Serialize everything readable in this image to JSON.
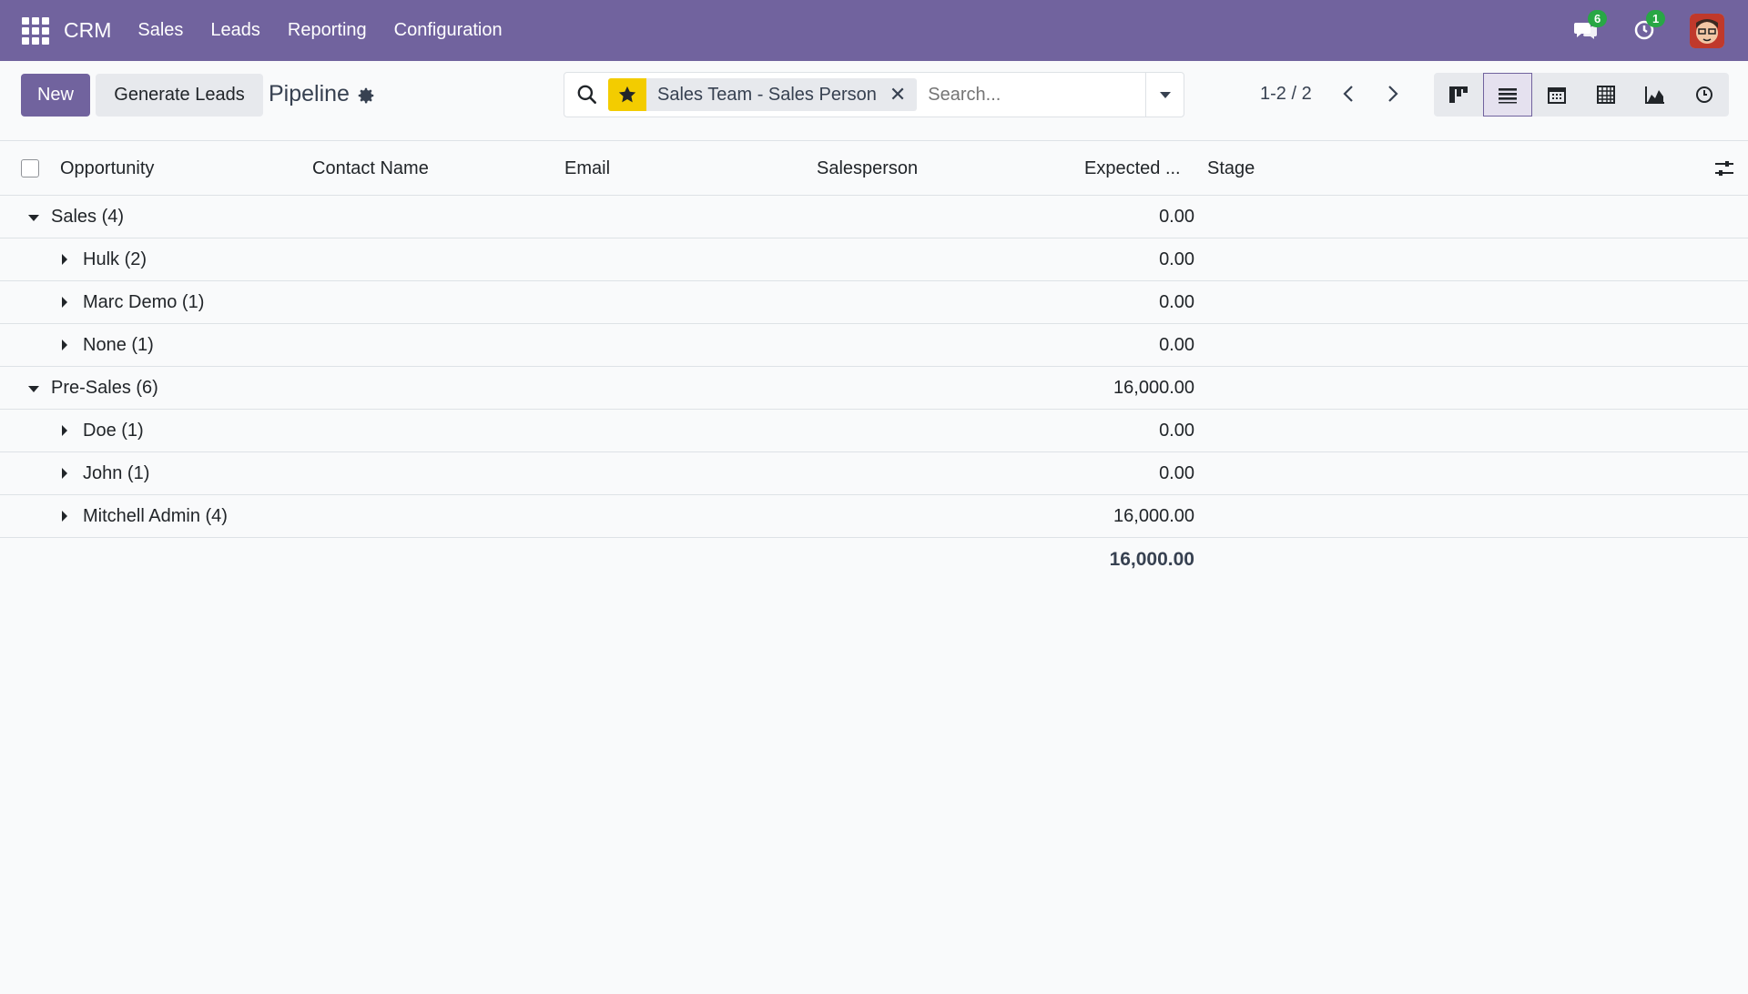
{
  "navbar": {
    "app_name": "CRM",
    "menu": [
      "Sales",
      "Leads",
      "Reporting",
      "Configuration"
    ],
    "messages_count": "6",
    "activities_count": "1",
    "accent_color": "#71639e"
  },
  "control_panel": {
    "new_label": "New",
    "generate_label": "Generate Leads",
    "title": "Pipeline",
    "search": {
      "facet_label": "Sales Team - Sales Person",
      "placeholder": "Search..."
    },
    "pager": "1-2 / 2",
    "views": [
      "kanban",
      "list",
      "calendar",
      "pivot",
      "graph",
      "activity"
    ],
    "active_view": "list"
  },
  "table": {
    "columns": [
      "Opportunity",
      "Contact Name",
      "Email",
      "Salesperson",
      "Expected ...",
      "Stage"
    ],
    "groups": [
      {
        "label": "Sales (4)",
        "value": "0.00",
        "level": 1
      },
      {
        "label": "Hulk (2)",
        "value": "0.00",
        "level": 2
      },
      {
        "label": "Marc Demo (1)",
        "value": "0.00",
        "level": 2
      },
      {
        "label": "None (1)",
        "value": "0.00",
        "level": 2
      },
      {
        "label": "Pre-Sales (6)",
        "value": "16,000.00",
        "level": 1
      },
      {
        "label": "Doe (1)",
        "value": "0.00",
        "level": 2
      },
      {
        "label": "John (1)",
        "value": "0.00",
        "level": 2
      },
      {
        "label": "Mitchell Admin (4)",
        "value": "16,000.00",
        "level": 2
      }
    ],
    "total": "16,000.00"
  }
}
